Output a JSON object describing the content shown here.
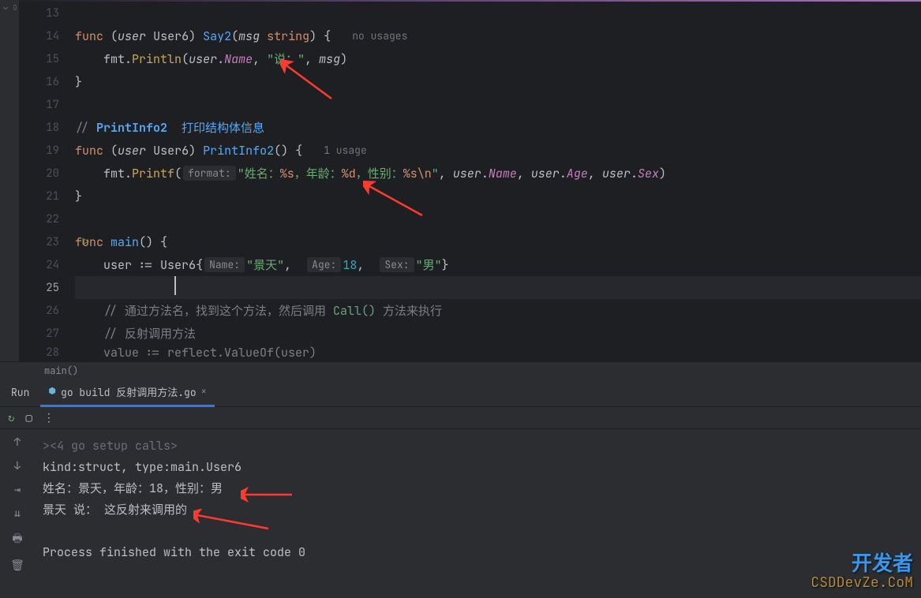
{
  "gutter": {
    "start": 13,
    "end": 28,
    "active": 25,
    "runnable": 23
  },
  "code": {
    "l13": "",
    "l14_func": "func",
    "l14_open": " (",
    "l14_user": "user",
    "l14_sp": " ",
    "l14_type": "User6",
    "l14_close": ") ",
    "l14_fn": "Say2",
    "l14_sig1": "(",
    "l14_msg": "msg",
    "l14_sp2": " ",
    "l14_str": "string",
    "l14_sig2": ") {",
    "l14_usage": "no usages",
    "l15_indent": "    ",
    "l15_fmt": "fmt",
    "l15_dot": ".",
    "l15_fn": "Println",
    "l15_op": "(",
    "l15_user": "user",
    "l15_dot2": ".",
    "l15_name": "Name",
    "l15_c": ", ",
    "l15_s1": "\"说：\"",
    "l15_c2": ", ",
    "l15_msg": "msg",
    "l15_cp": ")",
    "l16_close": "}",
    "l18_c": "//",
    "l18_fn": " PrintInfo2",
    "l18_txt": "  打印结构体信息",
    "l19_func": "func",
    "l19_open": " (",
    "l19_user": "user",
    "l19_type": "User6",
    "l19_close": ") ",
    "l19_fn": "PrintInfo2",
    "l19_sig": "() {",
    "l19_usage": "1 usage",
    "l20_indent": "    ",
    "l20_fmt": "fmt",
    "l20_fn": "Printf",
    "l20_op": "(",
    "l20_hint": "format:",
    "l20_s1a": "\"姓名：",
    "l20_f1": "%s",
    "l20_s1b": "，年龄：",
    "l20_f2": "%d",
    "l20_s1c": "，性别：",
    "l20_f3": "%s\\n",
    "l20_s1d": "\"",
    "l20_c": ", ",
    "l20_u": "user",
    "l20_name": "Name",
    "l20_age": "Age",
    "l20_sex": "Sex",
    "l20_cp": ")",
    "l21_close": "}",
    "l23_func": "func",
    "l23_main": "main",
    "l23_sig": "() {",
    "l24_indent": "    ",
    "l24_user": "user",
    "l24_assign": " := ",
    "l24_type": "User6",
    "l24_ob": "{",
    "l24_h1": "Name:",
    "l24_v1": "\"景天\"",
    "l24_c": ",",
    "l24_h2": "Age:",
    "l24_v2": "18",
    "l24_h3": "Sex:",
    "l24_v3": "\"男\"",
    "l24_cb": "}",
    "l26_indent": "    ",
    "l26_c": "// 通过方法名，找到这个方法，然后调用 ",
    "l26_fn": "Call()",
    "l26_c2": " 方法来执行",
    "l27_c": "// 反射调用方法",
    "l28_partial": "value := reflect.ValueOf(user)"
  },
  "breadcrumb": "main()",
  "run": {
    "label": "Run",
    "tab": "go build 反射调用方法.go",
    "console": {
      "l1": "<4 go setup calls>",
      "l2": "kind:struct,  type:main.User6",
      "l3": "姓名：景天，年龄：18，性别：男",
      "l4": "景天 说： 这反射来调用的",
      "l5": "Process finished with the exit code 0"
    }
  },
  "watermark": {
    "l1": "开发者",
    "l2": "CSDDevZe.CoM"
  }
}
